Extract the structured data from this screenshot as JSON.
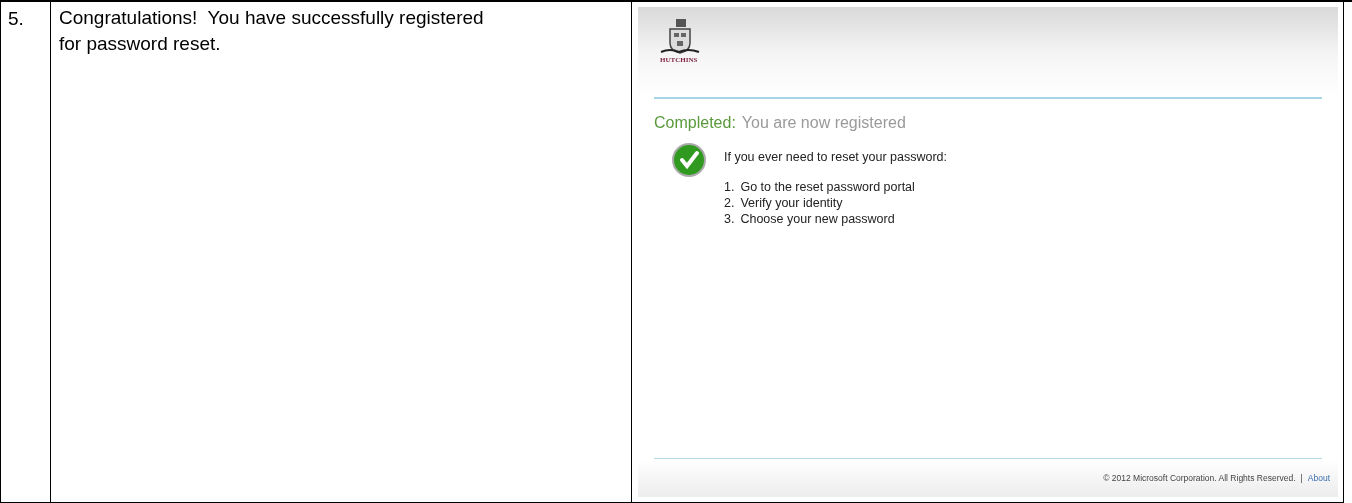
{
  "step": {
    "number": "5.",
    "text": "Congratulations!  You have successfully registered for password reset."
  },
  "screenshot": {
    "logo_text": "HUTCHINS",
    "status_label": "Completed:",
    "status_text": "You are now registered",
    "intro": "If you ever need to reset your password:",
    "steps": [
      {
        "number": "1.",
        "text": "Go to the reset password portal"
      },
      {
        "number": "2.",
        "text": "Verify your identity"
      },
      {
        "number": "3.",
        "text": "Choose your new password"
      }
    ],
    "footer": {
      "copyright": "© 2012 Microsoft Corporation. All Rights Reserved.",
      "separator": "|",
      "link": "About"
    }
  }
}
